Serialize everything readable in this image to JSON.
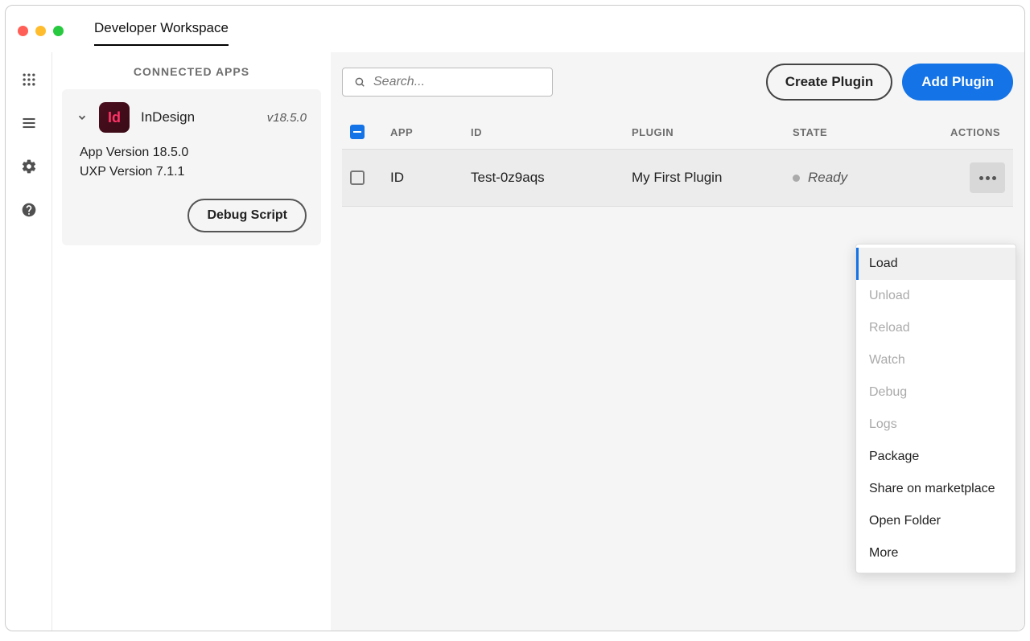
{
  "tab": {
    "title": "Developer Workspace"
  },
  "sidebar": {
    "title": "CONNECTED APPS",
    "app": {
      "icon_text": "Id",
      "name": "InDesign",
      "version": "v18.5.0",
      "app_version_label": "App Version 18.5.0",
      "uxp_version_label": "UXP Version 7.1.1",
      "debug_label": "Debug Script"
    }
  },
  "toolbar": {
    "search_placeholder": "Search...",
    "create_label": "Create Plugin",
    "add_label": "Add Plugin"
  },
  "table": {
    "headers": {
      "app": "APP",
      "id": "ID",
      "plugin": "PLUGIN",
      "state": "STATE",
      "actions": "ACTIONS"
    },
    "rows": [
      {
        "app": "ID",
        "id": "Test-0z9aqs",
        "plugin": "My First Plugin",
        "state": "Ready"
      }
    ]
  },
  "menu": {
    "items": [
      {
        "label": "Load",
        "highlighted": true,
        "disabled": false
      },
      {
        "label": "Unload",
        "highlighted": false,
        "disabled": true
      },
      {
        "label": "Reload",
        "highlighted": false,
        "disabled": true
      },
      {
        "label": "Watch",
        "highlighted": false,
        "disabled": true
      },
      {
        "label": "Debug",
        "highlighted": false,
        "disabled": true
      },
      {
        "label": "Logs",
        "highlighted": false,
        "disabled": true
      },
      {
        "label": "Package",
        "highlighted": false,
        "disabled": false
      },
      {
        "label": "Share on marketplace",
        "highlighted": false,
        "disabled": false
      },
      {
        "label": "Open Folder",
        "highlighted": false,
        "disabled": false
      },
      {
        "label": "More",
        "highlighted": false,
        "disabled": false
      }
    ]
  }
}
